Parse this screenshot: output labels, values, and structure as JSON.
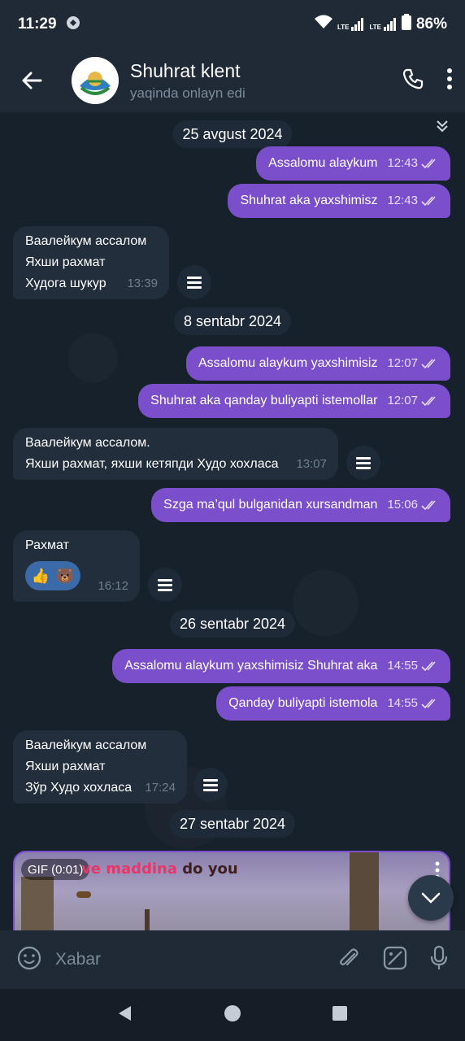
{
  "status_bar": {
    "time": "11:29",
    "battery": "86%",
    "net1": "LTE",
    "net2": "LTE"
  },
  "header": {
    "title": "Shuhrat klent",
    "subtitle": "yaqinda onlayn edi"
  },
  "messages": {
    "date1": "25 avgust 2024",
    "m1": {
      "text": "Assalomu alaykum",
      "time": "12:43"
    },
    "m2": {
      "text": "Shuhrat aka yaxshimisz",
      "time": "12:43"
    },
    "m3": {
      "lines": [
        "Ваалейкум ассалом",
        "Яхши рахмат",
        "Худога шукур"
      ],
      "time": "13:39"
    },
    "date2": "8 sentabr 2024",
    "m4": {
      "text": "Assalomu alaykum yaxshimisiz",
      "time": "12:07"
    },
    "m5": {
      "text": "Shuhrat aka qanday buliyapti istemollar",
      "time": "12:07"
    },
    "m6": {
      "lines": [
        "Ваалейкум ассалом.",
        "Яхши рахмат, яхши кетяпди Худо хохласа"
      ],
      "time": "13:07"
    },
    "m7": {
      "text": "Szga ma’qul bulganidan xursandman",
      "time": "15:06"
    },
    "m8": {
      "text": "Рахмат",
      "time": "16:12",
      "emoji1": "👍",
      "emoji2": "🐻"
    },
    "date3": "26 sentabr 2024",
    "m9": {
      "text": "Assalomu alaykum yaxshimisiz Shuhrat aka",
      "time": "14:55"
    },
    "m10": {
      "text": "Qanday buliyapti istemola",
      "time": "14:55"
    },
    "m11": {
      "lines": [
        "Ваалейкум ассалом",
        "Яхши рахмат",
        "Зўр Худо хохласа"
      ],
      "time": "17:24"
    },
    "date4": "27 sentabr 2024",
    "gif": {
      "badge": "GIF (0:01)",
      "caption_part1": "ve ",
      "caption_part2": "maddina",
      "caption_part3": " do you"
    }
  },
  "composer": {
    "placeholder": "Xabar"
  },
  "colors": {
    "outgoing": "#7b4fcb",
    "incoming": "#222e3b",
    "background": "#17212b",
    "header": "#1f2a36"
  }
}
